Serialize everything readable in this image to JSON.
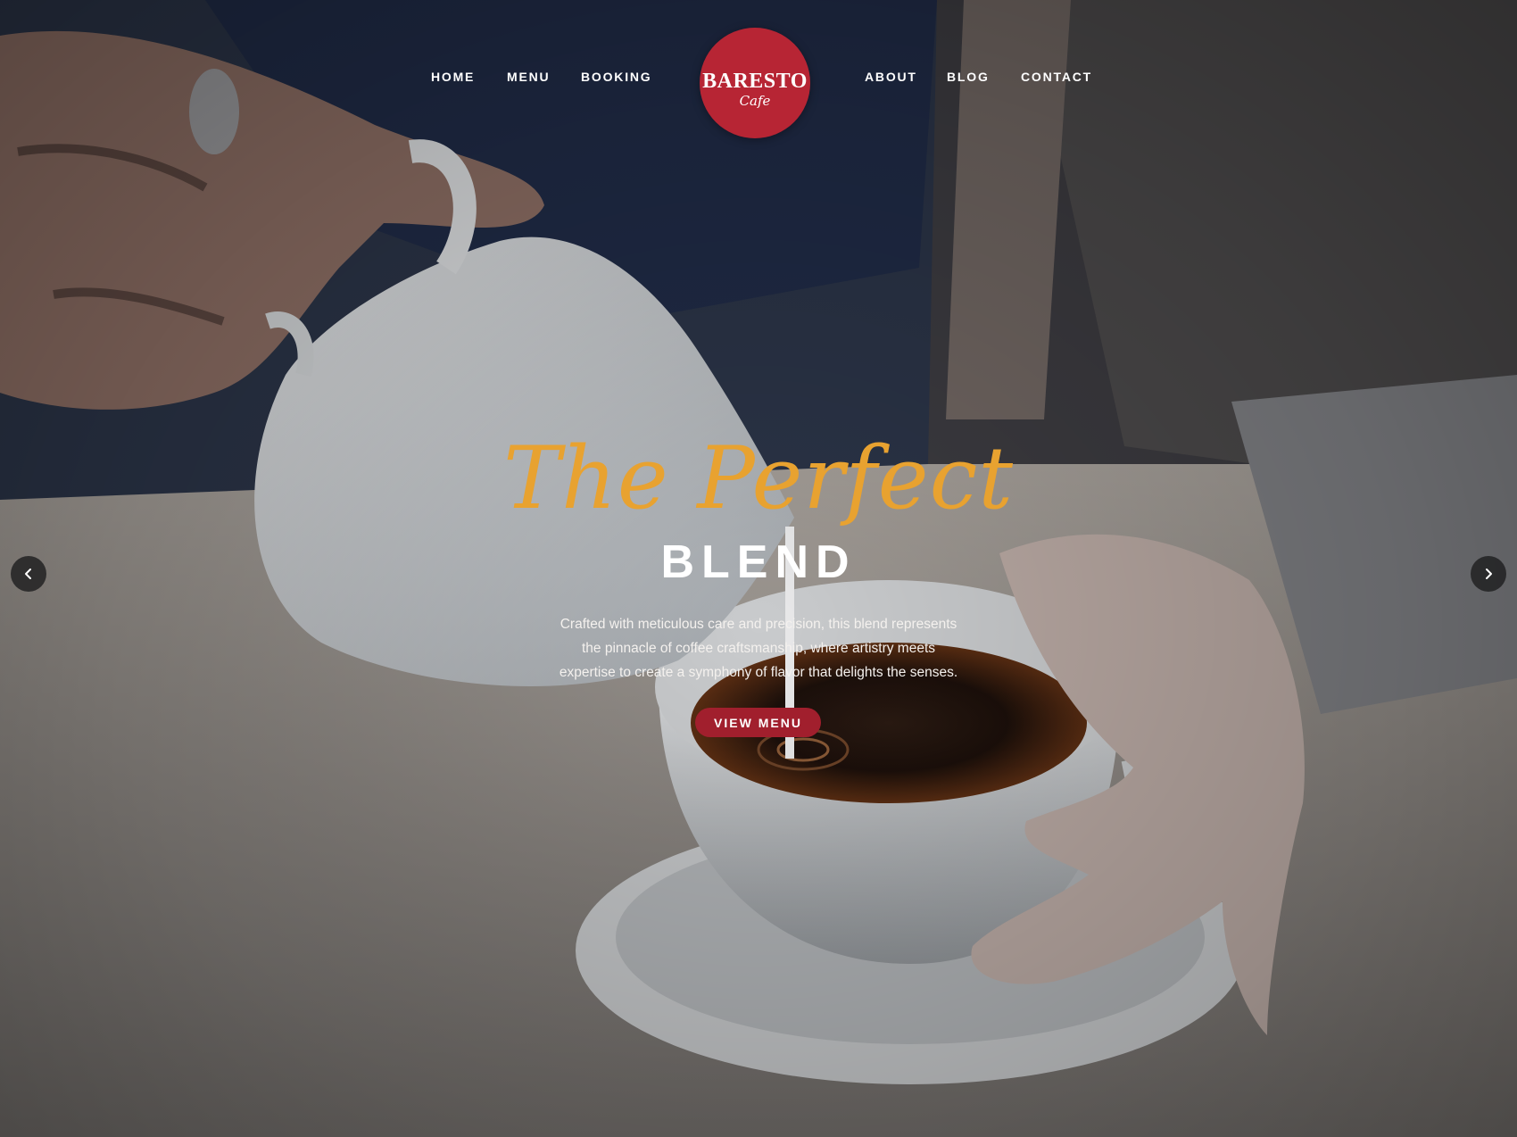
{
  "nav": {
    "left": [
      {
        "label": "HOME"
      },
      {
        "label": "MENU"
      },
      {
        "label": "BOOKING"
      }
    ],
    "right": [
      {
        "label": "ABOUT"
      },
      {
        "label": "BLOG"
      },
      {
        "label": "CONTACT"
      }
    ]
  },
  "logo": {
    "name": "BARESTO",
    "tagline": "Cafe",
    "color": "#b72534"
  },
  "hero": {
    "script_title": "The Perfect",
    "title": "BLEND",
    "description": "Crafted with meticulous care and precision, this blend represents the pinnacle of coffee craftsmanship, where artistry meets expertise to create a symphony of flavor that delights the senses.",
    "cta_label": "VIEW MENU",
    "accent_color": "#e8a230",
    "button_color": "#a11f2d"
  },
  "slider": {
    "prev_icon": "chevron-left-icon",
    "next_icon": "chevron-right-icon"
  }
}
